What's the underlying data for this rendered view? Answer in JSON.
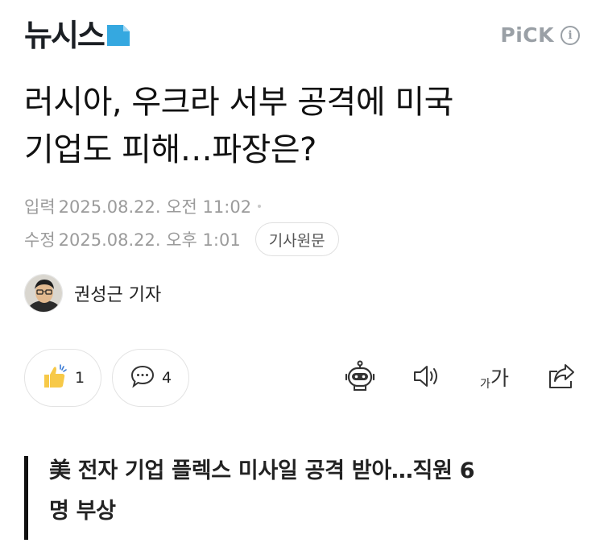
{
  "header": {
    "logo_text": "뉴시스",
    "pick_label": "PiCK",
    "info_glyph": "i"
  },
  "article": {
    "title_line1": "러시아, 우크라 서부 공격에 미국",
    "title_line2": "기업도 피해…파장은?",
    "input_label": "입력",
    "input_datetime": "2025.08.22. 오전 11:02",
    "modified_label": "수정",
    "modified_datetime": "2025.08.22. 오후 1:01",
    "source_button": "기사원문"
  },
  "reporter": {
    "name": "권성근 기자"
  },
  "actions": {
    "like_count": "1",
    "comment_count": "4",
    "font_small": "가",
    "font_big": "가"
  },
  "summary": {
    "line1": "美 전자 기업 플렉스 미사일 공격 받아…직원 6",
    "line2": "명 부상"
  },
  "icons": {
    "like": "thumbs-up-icon",
    "comment": "comment-icon",
    "bot": "robot-summary-icon",
    "audio": "speaker-icon",
    "share": "share-icon"
  },
  "colors": {
    "logo_accent": "#35a8e0",
    "muted": "#9b9b9b",
    "like_yellow": "#f7c948"
  }
}
